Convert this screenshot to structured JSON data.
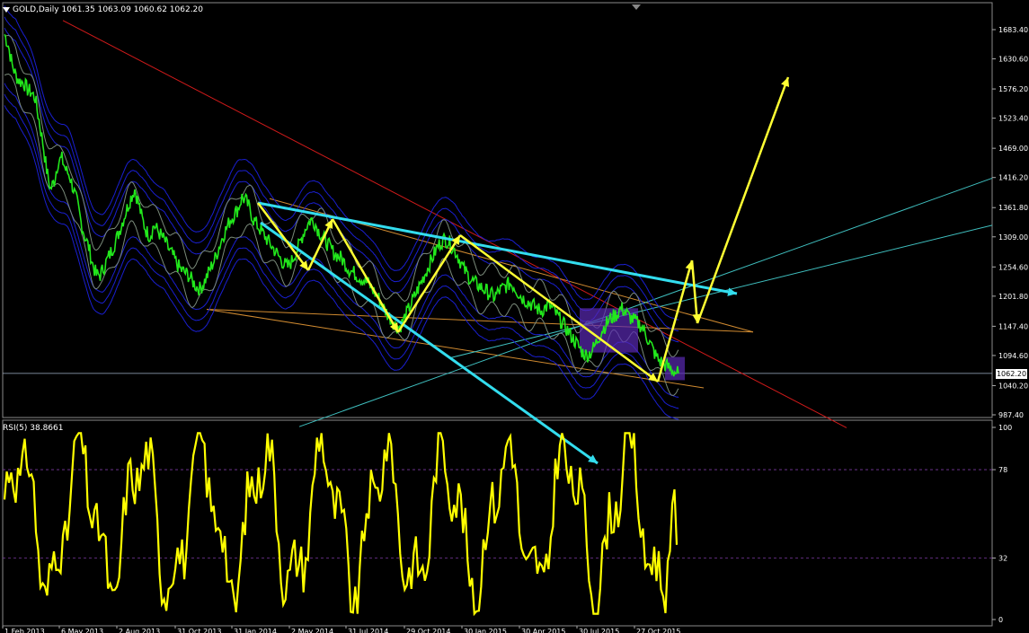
{
  "header": {
    "symbol": "GOLD,Daily",
    "open": "1061.35",
    "high": "1063.09",
    "low": "1060.62",
    "close": "1062.20"
  },
  "rsi_header": {
    "label": "RSI(5)",
    "value": "38.8661"
  },
  "current_price_label": "1062.20",
  "colors": {
    "background": "#000000",
    "price": "#22e81c",
    "rsi": "#ffff00",
    "annotation_yellow": "#ffff33",
    "annotation_cyan": "#33ddee",
    "envelope": "#1a1fd0",
    "bollinger": "#7a8a7a",
    "trend_red": "#d01a1a",
    "trend_orange": "#d08a30",
    "trend_teal": "#3fbfbf",
    "box_purple": "#5a2ab4"
  },
  "chart_data": [
    {
      "type": "line",
      "name": "price_panel",
      "yticks": [
        1683.4,
        1630.6,
        1576.2,
        1523.4,
        1469.0,
        1416.2,
        1361.8,
        1309.0,
        1254.6,
        1201.8,
        1147.4,
        1094.6,
        1040.2,
        987.4
      ],
      "ytick_labels": [
        "1683.40",
        "1630.60",
        "1576.20",
        "1523.40",
        "1469.00",
        "1416.20",
        "1361.80",
        "1309.00",
        "1254.60",
        "1201.80",
        "1147.40",
        "1094.60",
        "1040.20",
        "987.40"
      ],
      "ylim": [
        960,
        1710
      ],
      "xtick_labels": [
        "1 Feb 2013",
        "6 May 2013",
        "2 Aug 2013",
        "31 Oct 2013",
        "31 Jan 2014",
        "2 May 2014",
        "31 Jul 2014",
        "29 Oct 2014",
        "30 Jan 2015",
        "30 Apr 2015",
        "30 Jul 2015",
        "27 Oct 2015"
      ],
      "close_series": [
        1675,
        1655,
        1620,
        1600,
        1590,
        1588,
        1575,
        1570,
        1560,
        1520,
        1480,
        1430,
        1395,
        1410,
        1445,
        1450,
        1430,
        1420,
        1395,
        1370,
        1335,
        1310,
        1290,
        1260,
        1240,
        1240,
        1255,
        1270,
        1285,
        1300,
        1320,
        1340,
        1360,
        1380,
        1395,
        1370,
        1340,
        1320,
        1310,
        1330,
        1320,
        1310,
        1300,
        1285,
        1275,
        1260,
        1250,
        1245,
        1240,
        1230,
        1220,
        1215,
        1225,
        1240,
        1255,
        1270,
        1290,
        1310,
        1325,
        1340,
        1350,
        1360,
        1380,
        1375,
        1360,
        1340,
        1330,
        1320,
        1310,
        1300,
        1290,
        1280,
        1270,
        1260,
        1255,
        1265,
        1280,
        1295,
        1315,
        1330,
        1340,
        1335,
        1320,
        1310,
        1300,
        1290,
        1280,
        1275,
        1270,
        1260,
        1250,
        1245,
        1240,
        1235,
        1230,
        1225,
        1215,
        1205,
        1195,
        1180,
        1170,
        1160,
        1150,
        1145,
        1155,
        1170,
        1185,
        1200,
        1215,
        1230,
        1245,
        1260,
        1275,
        1290,
        1300,
        1305,
        1300,
        1290,
        1280,
        1265,
        1250,
        1240,
        1230,
        1225,
        1220,
        1215,
        1210,
        1205,
        1200,
        1210,
        1215,
        1220,
        1225,
        1220,
        1210,
        1200,
        1195,
        1190,
        1185,
        1180,
        1175,
        1180,
        1185,
        1180,
        1170,
        1160,
        1150,
        1140,
        1130,
        1120,
        1110,
        1100,
        1095,
        1100,
        1110,
        1125,
        1140,
        1150,
        1160,
        1165,
        1170,
        1180,
        1175,
        1165,
        1160,
        1155,
        1150,
        1140,
        1125,
        1110,
        1095,
        1085,
        1080,
        1075,
        1070,
        1065,
        1062
      ],
      "annotations": {
        "yellow_zigzag": [
          [
            "2014-03-14",
            1370
          ],
          [
            "2014-05-08",
            1290
          ],
          [
            "2014-06-10",
            1332
          ],
          [
            "2014-08-25",
            1215
          ],
          [
            "2014-10-28",
            1308
          ],
          [
            "2015-10-15",
            1062
          ],
          [
            "2015-11-20",
            1222
          ],
          [
            "2015-12-01",
            1160
          ],
          [
            "2016-01-20",
            1600
          ]
        ],
        "cyan_top_line": [
          [
            "2014-03-14",
            1370
          ],
          [
            "2016-02-15",
            1222
          ]
        ],
        "cyan_bottom_arrow": [
          [
            "2014-03-14",
            1270
          ],
          [
            "2015-07-20",
            985
          ]
        ]
      }
    },
    {
      "type": "line",
      "name": "RSI(5)",
      "yticks": [
        100,
        78,
        32,
        0
      ],
      "ytick_labels": [
        "100",
        "78",
        "32",
        "0"
      ],
      "ylim": [
        0,
        100
      ],
      "levels": [
        78,
        32
      ],
      "last_value": 38.8661
    }
  ]
}
